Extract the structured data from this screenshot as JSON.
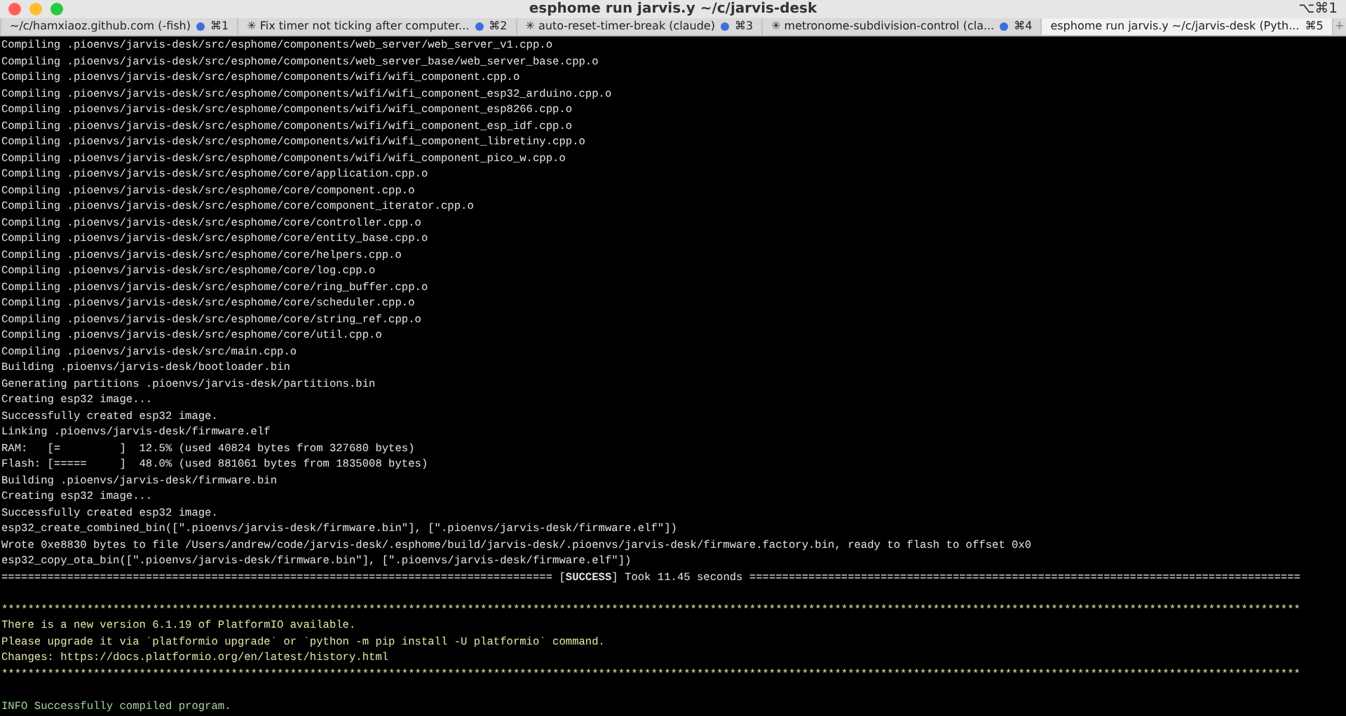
{
  "window": {
    "title": "esphome run jarvis.y ~/c/jarvis-desk",
    "shortcut": "⌥⌘1"
  },
  "tabs": [
    {
      "title": "~/c/hamxiaoz.github.com (-fish)",
      "shortcut": "⌘1",
      "activity": true,
      "selected": false
    },
    {
      "title": "✳ Fix timer not ticking after computer...",
      "shortcut": "⌘2",
      "activity": true,
      "selected": false
    },
    {
      "title": "✳ auto-reset-timer-break (claude)",
      "shortcut": "⌘3",
      "activity": true,
      "selected": false
    },
    {
      "title": "✳ metronome-subdivision-control (cla...",
      "shortcut": "⌘4",
      "activity": true,
      "selected": false
    },
    {
      "title": "esphome run jarvis.y ~/c/jarvis-desk (Pyth...",
      "shortcut": "⌘5",
      "activity": false,
      "selected": true
    }
  ],
  "new_tab": "+",
  "terminal": {
    "lines": [
      {
        "kind": "plain",
        "text": "Compiling .pioenvs/jarvis-desk/src/esphome/components/web_server/web_server_v1.cpp.o"
      },
      {
        "kind": "plain",
        "text": "Compiling .pioenvs/jarvis-desk/src/esphome/components/web_server_base/web_server_base.cpp.o"
      },
      {
        "kind": "plain",
        "text": "Compiling .pioenvs/jarvis-desk/src/esphome/components/wifi/wifi_component.cpp.o"
      },
      {
        "kind": "plain",
        "text": "Compiling .pioenvs/jarvis-desk/src/esphome/components/wifi/wifi_component_esp32_arduino.cpp.o"
      },
      {
        "kind": "plain",
        "text": "Compiling .pioenvs/jarvis-desk/src/esphome/components/wifi/wifi_component_esp8266.cpp.o"
      },
      {
        "kind": "plain",
        "text": "Compiling .pioenvs/jarvis-desk/src/esphome/components/wifi/wifi_component_esp_idf.cpp.o"
      },
      {
        "kind": "plain",
        "text": "Compiling .pioenvs/jarvis-desk/src/esphome/components/wifi/wifi_component_libretiny.cpp.o"
      },
      {
        "kind": "plain",
        "text": "Compiling .pioenvs/jarvis-desk/src/esphome/components/wifi/wifi_component_pico_w.cpp.o"
      },
      {
        "kind": "plain",
        "text": "Compiling .pioenvs/jarvis-desk/src/esphome/core/application.cpp.o"
      },
      {
        "kind": "plain",
        "text": "Compiling .pioenvs/jarvis-desk/src/esphome/core/component.cpp.o"
      },
      {
        "kind": "plain",
        "text": "Compiling .pioenvs/jarvis-desk/src/esphome/core/component_iterator.cpp.o"
      },
      {
        "kind": "plain",
        "text": "Compiling .pioenvs/jarvis-desk/src/esphome/core/controller.cpp.o"
      },
      {
        "kind": "plain",
        "text": "Compiling .pioenvs/jarvis-desk/src/esphome/core/entity_base.cpp.o"
      },
      {
        "kind": "plain",
        "text": "Compiling .pioenvs/jarvis-desk/src/esphome/core/helpers.cpp.o"
      },
      {
        "kind": "plain",
        "text": "Compiling .pioenvs/jarvis-desk/src/esphome/core/log.cpp.o"
      },
      {
        "kind": "plain",
        "text": "Compiling .pioenvs/jarvis-desk/src/esphome/core/ring_buffer.cpp.o"
      },
      {
        "kind": "plain",
        "text": "Compiling .pioenvs/jarvis-desk/src/esphome/core/scheduler.cpp.o"
      },
      {
        "kind": "plain",
        "text": "Compiling .pioenvs/jarvis-desk/src/esphome/core/string_ref.cpp.o"
      },
      {
        "kind": "plain",
        "text": "Compiling .pioenvs/jarvis-desk/src/esphome/core/util.cpp.o"
      },
      {
        "kind": "plain",
        "text": "Compiling .pioenvs/jarvis-desk/src/main.cpp.o"
      },
      {
        "kind": "plain",
        "text": "Building .pioenvs/jarvis-desk/bootloader.bin"
      },
      {
        "kind": "plain",
        "text": "Generating partitions .pioenvs/jarvis-desk/partitions.bin"
      },
      {
        "kind": "plain",
        "text": "Creating esp32 image..."
      },
      {
        "kind": "plain",
        "text": "Successfully created esp32 image."
      },
      {
        "kind": "plain",
        "text": "Linking .pioenvs/jarvis-desk/firmware.elf"
      },
      {
        "kind": "plain",
        "text": "RAM:   [=         ]  12.5% (used 40824 bytes from 327680 bytes)"
      },
      {
        "kind": "plain",
        "text": "Flash: [=====     ]  48.0% (used 881061 bytes from 1835008 bytes)"
      },
      {
        "kind": "plain",
        "text": "Building .pioenvs/jarvis-desk/firmware.bin"
      },
      {
        "kind": "plain",
        "text": "Creating esp32 image..."
      },
      {
        "kind": "plain",
        "text": "Successfully created esp32 image."
      },
      {
        "kind": "plain",
        "text": "esp32_create_combined_bin([\".pioenvs/jarvis-desk/firmware.bin\"], [\".pioenvs/jarvis-desk/firmware.elf\"])"
      },
      {
        "kind": "plain",
        "text": "Wrote 0xe8830 bytes to file /Users/andrew/code/jarvis-desk/.esphome/build/jarvis-desk/.pioenvs/jarvis-desk/firmware.factory.bin, ready to flash to offset 0x0"
      },
      {
        "kind": "plain",
        "text": "esp32_copy_ota_bin([\".pioenvs/jarvis-desk/firmware.bin\"], [\".pioenvs/jarvis-desk/firmware.elf\"])"
      },
      {
        "kind": "status",
        "text": "==================================================================================== [**SUCCESS**] Took 11.45 seconds ===================================================================================="
      },
      {
        "kind": "blank"
      },
      {
        "kind": "notice",
        "text": "******************************************************************************************************************************************************************************************************"
      },
      {
        "kind": "notice",
        "text": "There is a new version 6.1.19 of PlatformIO available."
      },
      {
        "kind": "notice",
        "text": "Please upgrade it via `platformio upgrade` or `python -m pip install -U platformio` command."
      },
      {
        "kind": "notice",
        "text": "Changes: https://docs.platformio.org/en/latest/history.html"
      },
      {
        "kind": "notice",
        "text": "******************************************************************************************************************************************************************************************************"
      },
      {
        "kind": "blank"
      },
      {
        "kind": "info",
        "text": "INFO Successfully compiled program."
      }
    ]
  }
}
